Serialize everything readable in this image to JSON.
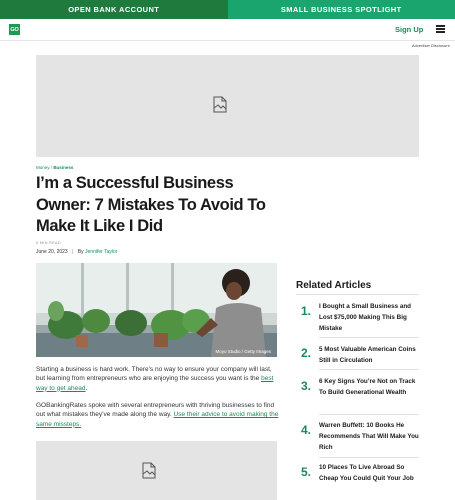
{
  "topbar": {
    "left_label": "OPEN BANK ACCOUNT",
    "right_label": "SMALL BUSINESS SPOTLIGHT"
  },
  "header": {
    "logo_text": "GO",
    "signup_label": "Sign Up",
    "menu_icon": "hamburger-menu-icon"
  },
  "advertiser_disclosure": "Advertiser Disclosure",
  "ad_placeholder_icon": "broken-image-icon",
  "breadcrumb": {
    "first": "Money",
    "separator": "/",
    "second": "Business"
  },
  "article": {
    "title": "I’m a Successful Business Owner: 7 Mistakes To Avoid To Make It Like I Did",
    "read_time": "5 MIN READ",
    "date": "June 20, 2023",
    "byline_separator": "|",
    "by_label": "By",
    "author": "Jennifer Taylor",
    "image_credit": "Moyo Studio / Getty Images",
    "para1_text": "Starting a business is hard work. There’s no way to ensure your company will last, but learning from entrepreneurs who are enjoying the success you want is the ",
    "para1_link": "best way to get ahead",
    "para1_end": ".",
    "para2_text": "GOBankingRates spoke with several entrepreneurs with thriving businesses to find out what mistakes they’ve made along the way. ",
    "para2_link": "Use their advice to avoid making the same missteps."
  },
  "related": {
    "title": "Related Articles",
    "items": [
      {
        "num": "1.",
        "text": "I Bought a Small Business and Lost $75,000 Making This Big Mistake"
      },
      {
        "num": "2.",
        "text": "5 Most Valuable American Coins Still in Circulation"
      },
      {
        "num": "3.",
        "text": "6 Key Signs You’re Not on Track To Build Generational Wealth"
      },
      {
        "num": "4.",
        "text": "Warren Buffett: 10 Books He Recommends That Will Make You Rich"
      },
      {
        "num": "5.",
        "text": "10 Places To Live Abroad So Cheap You Could Quit Your Job"
      }
    ]
  }
}
